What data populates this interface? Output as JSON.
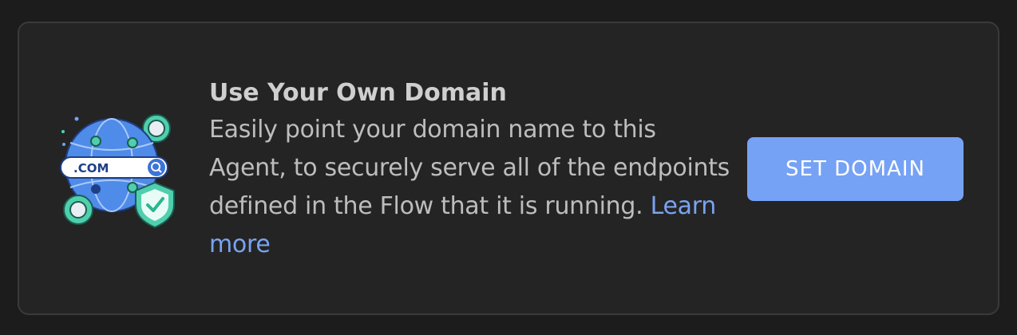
{
  "card": {
    "title": "Use Your Own Domain",
    "description": "Easily point your domain name to this Agent, to securely serve all of the endpoints defined in the Flow that it is running.",
    "learn_more_label": "Learn more",
    "button_label": "SET DOMAIN",
    "illustration": {
      "icon": "globe-domain-icon",
      "domain_label": ".COM"
    }
  },
  "colors": {
    "background": "#1c1c1c",
    "card_background": "#242424",
    "accent": "#76a2f5",
    "link": "#7aa3f0"
  }
}
